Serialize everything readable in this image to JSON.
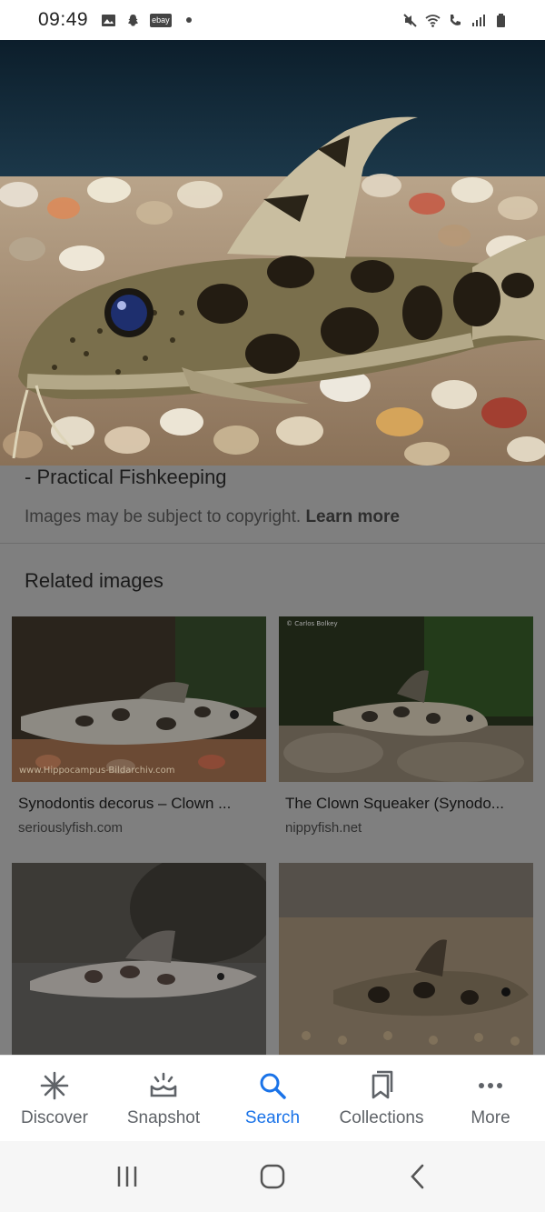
{
  "status_bar": {
    "time": "09:49",
    "ebay_label": "ebay"
  },
  "hero": {
    "icon": "hero-fish-photo"
  },
  "result": {
    "source_title": "- Practical Fishkeeping",
    "copyright_text": "Images may be subject to copyright.",
    "learn_more": "Learn more"
  },
  "related": {
    "title": "Related images",
    "items": [
      {
        "caption": "Synodontis decorus – Clown ...",
        "source": "seriouslyfish.com",
        "watermark": "www.Hippocampus-Bildarchiv.com"
      },
      {
        "caption": "The Clown Squeaker (Synodo...",
        "source": "nippyfish.net",
        "watermark": "© Carlos Bolkey"
      },
      {
        "caption": "",
        "source": ""
      },
      {
        "caption": "",
        "source": ""
      }
    ]
  },
  "bottom_nav": {
    "items": [
      {
        "label": "Discover",
        "icon": "discover-icon"
      },
      {
        "label": "Snapshot",
        "icon": "snapshot-icon"
      },
      {
        "label": "Search",
        "icon": "search-icon"
      },
      {
        "label": "Collections",
        "icon": "collections-icon"
      },
      {
        "label": "More",
        "icon": "more-icon"
      }
    ],
    "active": "Search",
    "active_color": "#1a73e8",
    "inactive_color": "#5f6368"
  }
}
